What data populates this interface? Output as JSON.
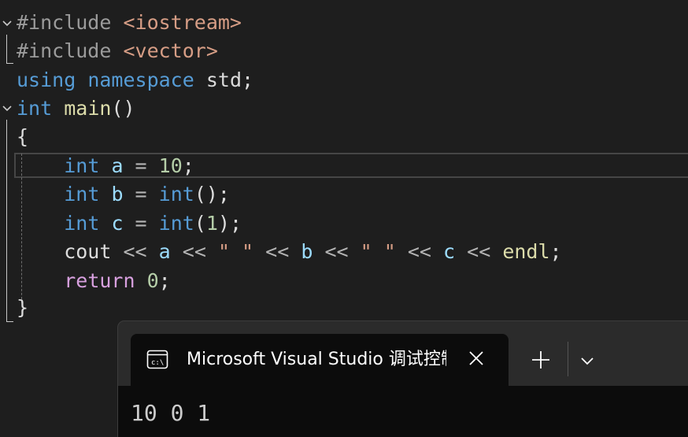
{
  "editor": {
    "lines": [
      {
        "parts": [
          {
            "t": "#include ",
            "c": "pp"
          },
          {
            "t": "<iostream>",
            "c": "str"
          }
        ]
      },
      {
        "parts": [
          {
            "t": "#include ",
            "c": "pp"
          },
          {
            "t": "<vector>",
            "c": "str"
          }
        ]
      },
      {
        "parts": [
          {
            "t": "using",
            "c": "kw"
          },
          {
            "t": " ",
            "c": "plain"
          },
          {
            "t": "namespace",
            "c": "kw"
          },
          {
            "t": " std;",
            "c": "plain"
          }
        ]
      },
      {
        "parts": [
          {
            "t": "int",
            "c": "kw"
          },
          {
            "t": " ",
            "c": "plain"
          },
          {
            "t": "main",
            "c": "fn"
          },
          {
            "t": "()",
            "c": "plain"
          }
        ]
      },
      {
        "parts": [
          {
            "t": "{",
            "c": "plain"
          }
        ]
      },
      {
        "parts": [
          {
            "t": "    ",
            "c": "plain"
          },
          {
            "t": "int",
            "c": "kw"
          },
          {
            "t": " ",
            "c": "plain"
          },
          {
            "t": "a",
            "c": "var"
          },
          {
            "t": " = ",
            "c": "op"
          },
          {
            "t": "10",
            "c": "num"
          },
          {
            "t": ";",
            "c": "plain"
          }
        ]
      },
      {
        "parts": [
          {
            "t": "    ",
            "c": "plain"
          },
          {
            "t": "int",
            "c": "kw"
          },
          {
            "t": " ",
            "c": "plain"
          },
          {
            "t": "b",
            "c": "var"
          },
          {
            "t": " = ",
            "c": "op"
          },
          {
            "t": "int",
            "c": "kw"
          },
          {
            "t": "();",
            "c": "plain"
          }
        ]
      },
      {
        "parts": [
          {
            "t": "    ",
            "c": "plain"
          },
          {
            "t": "int",
            "c": "kw"
          },
          {
            "t": " ",
            "c": "plain"
          },
          {
            "t": "c",
            "c": "var"
          },
          {
            "t": " = ",
            "c": "op"
          },
          {
            "t": "int",
            "c": "kw"
          },
          {
            "t": "(",
            "c": "plain"
          },
          {
            "t": "1",
            "c": "num"
          },
          {
            "t": ");",
            "c": "plain"
          }
        ]
      },
      {
        "parts": [
          {
            "t": "    cout ",
            "c": "plain"
          },
          {
            "t": "<<",
            "c": "op"
          },
          {
            "t": " ",
            "c": "plain"
          },
          {
            "t": "a",
            "c": "var"
          },
          {
            "t": " ",
            "c": "plain"
          },
          {
            "t": "<<",
            "c": "op"
          },
          {
            "t": " ",
            "c": "plain"
          },
          {
            "t": "\" \"",
            "c": "str"
          },
          {
            "t": " ",
            "c": "plain"
          },
          {
            "t": "<<",
            "c": "op"
          },
          {
            "t": " ",
            "c": "plain"
          },
          {
            "t": "b",
            "c": "var"
          },
          {
            "t": " ",
            "c": "plain"
          },
          {
            "t": "<<",
            "c": "op"
          },
          {
            "t": " ",
            "c": "plain"
          },
          {
            "t": "\" \"",
            "c": "str"
          },
          {
            "t": " ",
            "c": "plain"
          },
          {
            "t": "<<",
            "c": "op"
          },
          {
            "t": " ",
            "c": "plain"
          },
          {
            "t": "c",
            "c": "var"
          },
          {
            "t": " ",
            "c": "plain"
          },
          {
            "t": "<<",
            "c": "op"
          },
          {
            "t": " ",
            "c": "plain"
          },
          {
            "t": "endl",
            "c": "fn"
          },
          {
            "t": ";",
            "c": "plain"
          }
        ]
      },
      {
        "parts": [
          {
            "t": "    ",
            "c": "plain"
          },
          {
            "t": "return",
            "c": "ret"
          },
          {
            "t": " ",
            "c": "plain"
          },
          {
            "t": "0",
            "c": "num"
          },
          {
            "t": ";",
            "c": "plain"
          }
        ]
      },
      {
        "parts": [
          {
            "t": "}",
            "c": "plain"
          }
        ]
      }
    ]
  },
  "terminal": {
    "tab_icon": "console-icon",
    "tab_title": "Microsoft Visual Studio 调试控制台",
    "close_icon": "close-icon",
    "new_tab_icon": "plus-icon",
    "dropdown_icon": "chevron-down-icon",
    "output": "10 0 1"
  },
  "colors": {
    "background": "#1e1e1e",
    "keyword": "#569cd6",
    "function": "#dcdcaa",
    "string": "#d69d85",
    "preprocessor": "#9b9b9b",
    "number": "#b5cea8",
    "variable": "#9cdcfe",
    "control": "#d8a0df",
    "terminal_bg": "#0c0c0c",
    "terminal_frame": "#2b2b2b"
  }
}
